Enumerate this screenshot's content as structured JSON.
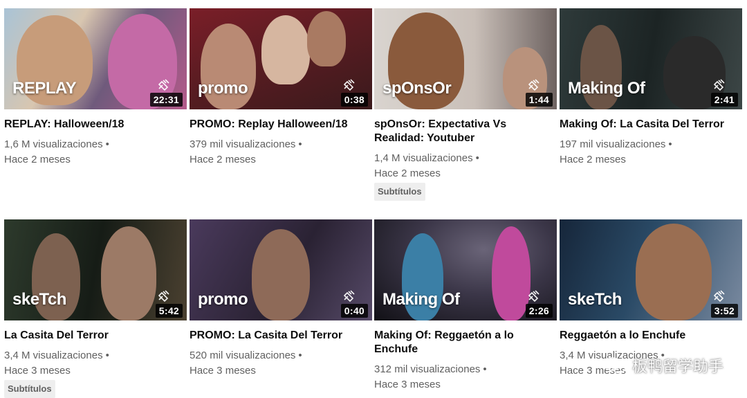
{
  "videos": [
    {
      "brand": "REPLAY",
      "duration": "22:31",
      "title": "REPLAY: Halloween/18",
      "views": "1,6 M visualizaciones",
      "age": "Hace 2 meses",
      "badge": "",
      "colors": [
        "#a9c3d6",
        "#6f5a7c"
      ]
    },
    {
      "brand": "promo",
      "duration": "0:38",
      "title": "PROMO: Replay Halloween/18",
      "views": "379 mil visualizaciones",
      "age": "Hace 2 meses",
      "badge": "",
      "colors": [
        "#5b1c22",
        "#3a1a1c"
      ]
    },
    {
      "brand": "spOnsOr",
      "duration": "1:44",
      "title": "spOnsOr: Expectativa Vs Realidad: Youtuber",
      "views": "1,4 M visualizaciones",
      "age": "Hace 2 meses",
      "badge": "Subtítulos",
      "colors": [
        "#d9d4cf",
        "#6e6361"
      ]
    },
    {
      "brand": "Making Of",
      "duration": "2:41",
      "title": "Making Of: La Casita Del Terror",
      "views": "197 mil visualizaciones",
      "age": "Hace 2 meses",
      "badge": "",
      "colors": [
        "#2e3a3a",
        "#141818"
      ]
    },
    {
      "brand": "skeTch",
      "duration": "5:42",
      "title": "La Casita Del Terror",
      "views": "3,4 M visualizaciones",
      "age": "Hace 3 meses",
      "badge": "Subtítulos",
      "colors": [
        "#2d3a2c",
        "#161c16"
      ]
    },
    {
      "brand": "promo",
      "duration": "0:40",
      "title": "PROMO: La Casita Del Terror",
      "views": "520 mil visualizaciones",
      "age": "Hace 3 meses",
      "badge": "",
      "colors": [
        "#4a3a5c",
        "#2a2233"
      ]
    },
    {
      "brand": "Making Of",
      "duration": "2:26",
      "title": "Making Of: Reggaetón a lo Enchufe",
      "views": "312 mil visualizaciones",
      "age": "Hace 3 meses",
      "badge": "",
      "colors": [
        "#3b3648",
        "#111015"
      ]
    },
    {
      "brand": "skeTch",
      "duration": "3:52",
      "title": "Reggaetón a lo Enchufe",
      "views": "3,4 M visualizaciones",
      "age": "Hace 3 meses",
      "badge": "",
      "colors": [
        "#2a4a66",
        "#16263a"
      ]
    }
  ],
  "watermark": {
    "text": "板鸭留学助手"
  },
  "icons": {
    "plug": "plug-icon",
    "watermark_logo": "wechat-logo-icon"
  }
}
